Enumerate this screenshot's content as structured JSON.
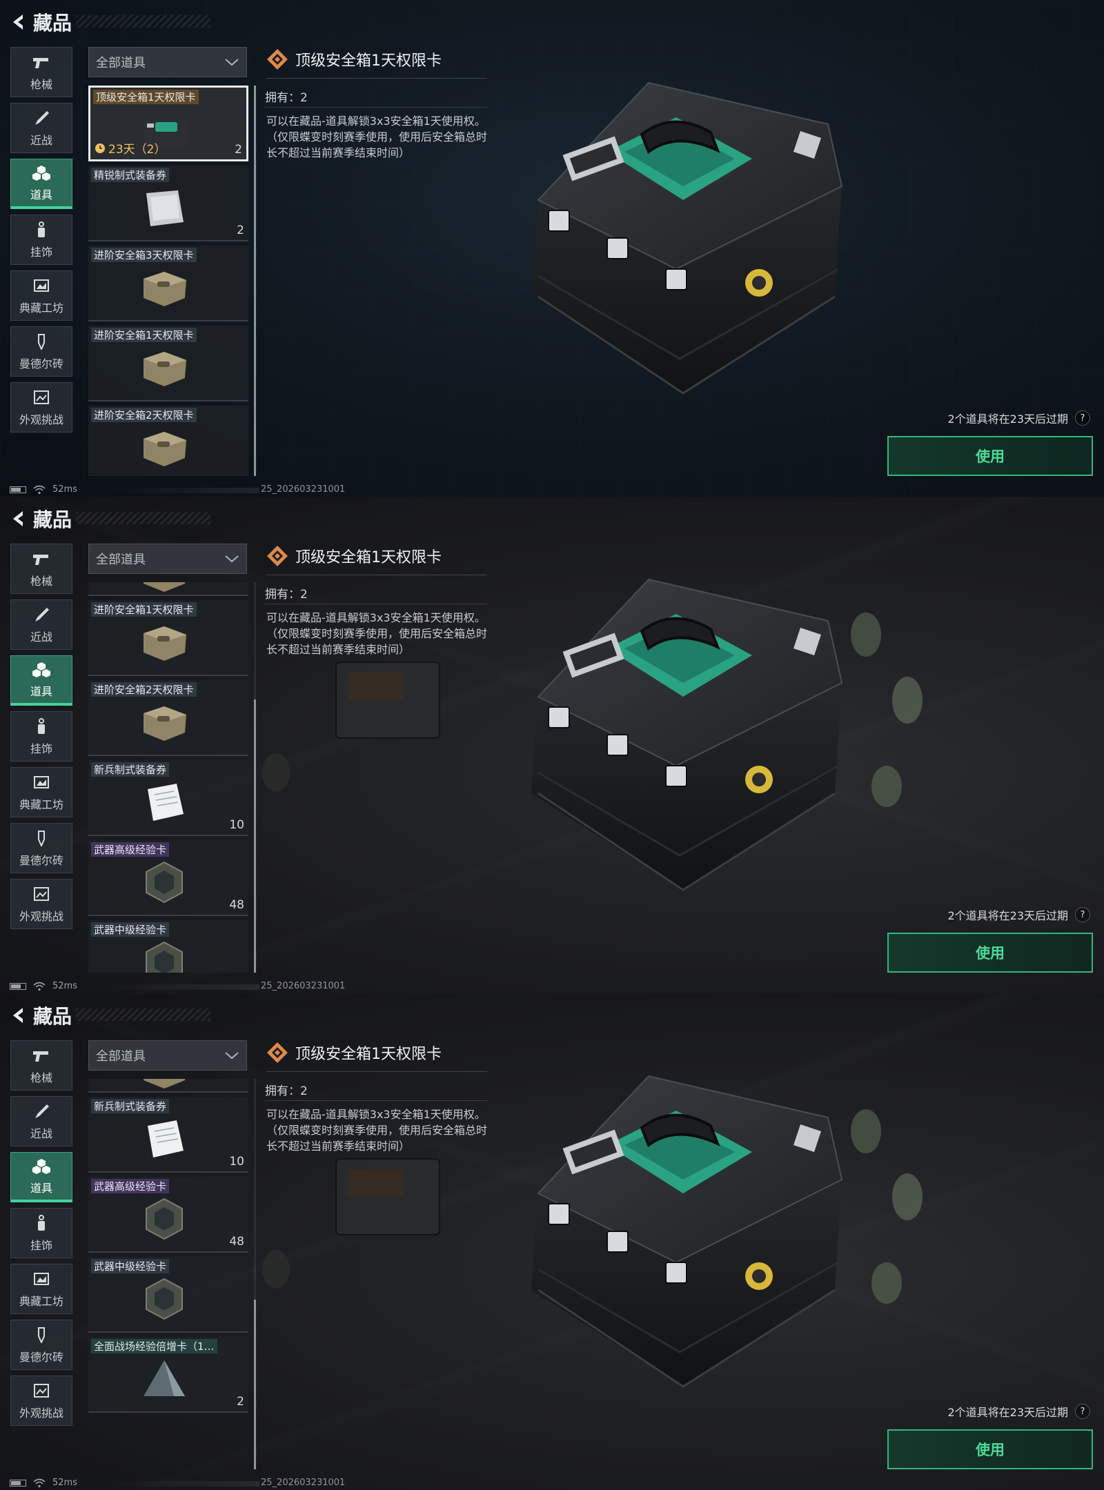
{
  "app": {
    "title": "藏品"
  },
  "categories": [
    {
      "label": "枪械",
      "icon": "pistol-icon"
    },
    {
      "label": "近战",
      "icon": "knife-icon"
    },
    {
      "label": "道具",
      "icon": "items-icon",
      "active": true
    },
    {
      "label": "挂饰",
      "icon": "charm-icon"
    },
    {
      "label": "典藏工坊",
      "icon": "workshop-icon"
    },
    {
      "label": "曼德尔砖",
      "icon": "brick-icon"
    },
    {
      "label": "外观挑战",
      "icon": "challenge-icon"
    }
  ],
  "filter": {
    "selected": "全部道具"
  },
  "screens": [
    {
      "list": [
        {
          "name": "顶级安全箱1天权限卡",
          "timer": "23天（2）",
          "count": "2",
          "selected": true,
          "tag": "gold",
          "thumb": "black-case"
        },
        {
          "name": "精锐制式装备券",
          "count": "2",
          "tag": "normal",
          "thumb": "bag"
        },
        {
          "name": "进阶安全箱3天权限卡",
          "count": "",
          "tag": "normal",
          "thumb": "tan-case"
        },
        {
          "name": "进阶安全箱1天权限卡",
          "count": "",
          "tag": "normal",
          "thumb": "tan-case"
        },
        {
          "name": "进阶安全箱2天权限卡",
          "count": "",
          "tag": "normal",
          "thumb": "tan-case"
        }
      ]
    },
    {
      "list": [
        {
          "name": "",
          "count": "",
          "tag": "normal",
          "thumb": "tan-case",
          "partial": true
        },
        {
          "name": "进阶安全箱1天权限卡",
          "count": "",
          "tag": "normal",
          "thumb": "tan-case"
        },
        {
          "name": "进阶安全箱2天权限卡",
          "count": "",
          "tag": "normal",
          "thumb": "tan-case"
        },
        {
          "name": "新兵制式装备券",
          "count": "10",
          "tag": "normal",
          "thumb": "paper"
        },
        {
          "name": "武器高级经验卡",
          "count": "48",
          "tag": "purple",
          "thumb": "hex"
        },
        {
          "name": "武器中级经验卡",
          "count": "",
          "tag": "normal",
          "thumb": "hex"
        }
      ]
    },
    {
      "list": [
        {
          "name": "",
          "count": "",
          "tag": "normal",
          "thumb": "tan-case",
          "partial": true
        },
        {
          "name": "新兵制式装备券",
          "count": "10",
          "tag": "normal",
          "thumb": "paper"
        },
        {
          "name": "武器高级经验卡",
          "count": "48",
          "tag": "purple",
          "thumb": "hex"
        },
        {
          "name": "武器中级经验卡",
          "count": "",
          "tag": "normal",
          "thumb": "hex"
        },
        {
          "name": "全面战场经验倍增卡（1…",
          "count": "2",
          "tag": "teal",
          "thumb": "tent"
        }
      ]
    }
  ],
  "detail": {
    "title": "顶级安全箱1天权限卡",
    "owned": "拥有：2",
    "description": "可以在藏品-道具解锁3x3安全箱1天使用权。（仅限蝶变时刻赛季使用，使用后安全箱总时长不超过当前赛季结束时间）"
  },
  "expire_note": "2个道具将在23天后过期",
  "help": "?",
  "use_label": "使用",
  "status": {
    "ping": "52ms",
    "version": "25_202603231001"
  },
  "colors": {
    "accent": "#42d39a",
    "gold": "#f0c060",
    "case_teal": "#2aa383"
  }
}
